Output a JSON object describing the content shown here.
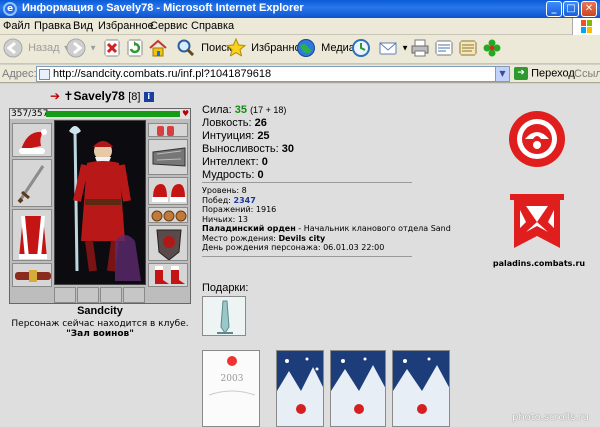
{
  "window": {
    "title": "Информация о Savely78 - Microsoft Internet Explorer",
    "controls": [
      "_",
      "□",
      "✕"
    ]
  },
  "menu": [
    "Файл",
    "Правка",
    "Вид",
    "Избранное",
    "Сервис",
    "Справка"
  ],
  "toolbar": {
    "back": "Назад",
    "search": "Поиск",
    "favorites": "Избранное",
    "media": "Медиа"
  },
  "addressbar": {
    "label": "Адрес:",
    "url": "http://sandcity.combats.ru/inf.pl?1041879618",
    "go": "Переход",
    "links": "Ссылки"
  },
  "character": {
    "name": "Savely78",
    "level": "[8]",
    "hp": "357/357",
    "hp_fraction": 1.0,
    "city": "Sandcity",
    "location_text": "Персонаж сейчас находится в клубе.",
    "location_place": "\"Зал воинов\""
  },
  "stats": {
    "strength_label": "Сила:",
    "strength_value": "35",
    "strength_extra": "(17 + 18)",
    "agility_label": "Ловкость:",
    "agility_value": "26",
    "intuition_label": "Интуиция:",
    "intuition_value": "25",
    "endurance_label": "Выносливость:",
    "endurance_value": "30",
    "intellect_label": "Интеллект:",
    "intellect_value": "0",
    "wisdom_label": "Мудрость:",
    "wisdom_value": "0"
  },
  "details": {
    "level_label": "Уровень:",
    "level_value": "8",
    "wins_label": "Побед:",
    "wins_value": "2347",
    "losses_label": "Поражений:",
    "losses_value": "1916",
    "draws_label": "Ничьих:",
    "draws_value": "13",
    "order_label": "Паладинский орден",
    "order_role": "- Начальник кланового отдела Sand",
    "birthplace_label": "Место рождения:",
    "birthplace_value": "Devils city",
    "birthday_label": "День рождения персонажа:",
    "birthday_value": "06.01.03 22:00"
  },
  "gifts": {
    "label": "Подарки:",
    "card_year": "2003"
  },
  "emblem_caption": "paladins.combats.ru",
  "watermark": "photo.scrolls.ru",
  "colors": {
    "hp_bar": "#159c15",
    "emblem_red": "#e01e1e",
    "strength_green": "#118c11",
    "titlebar_blue": "#0a5bd8"
  }
}
